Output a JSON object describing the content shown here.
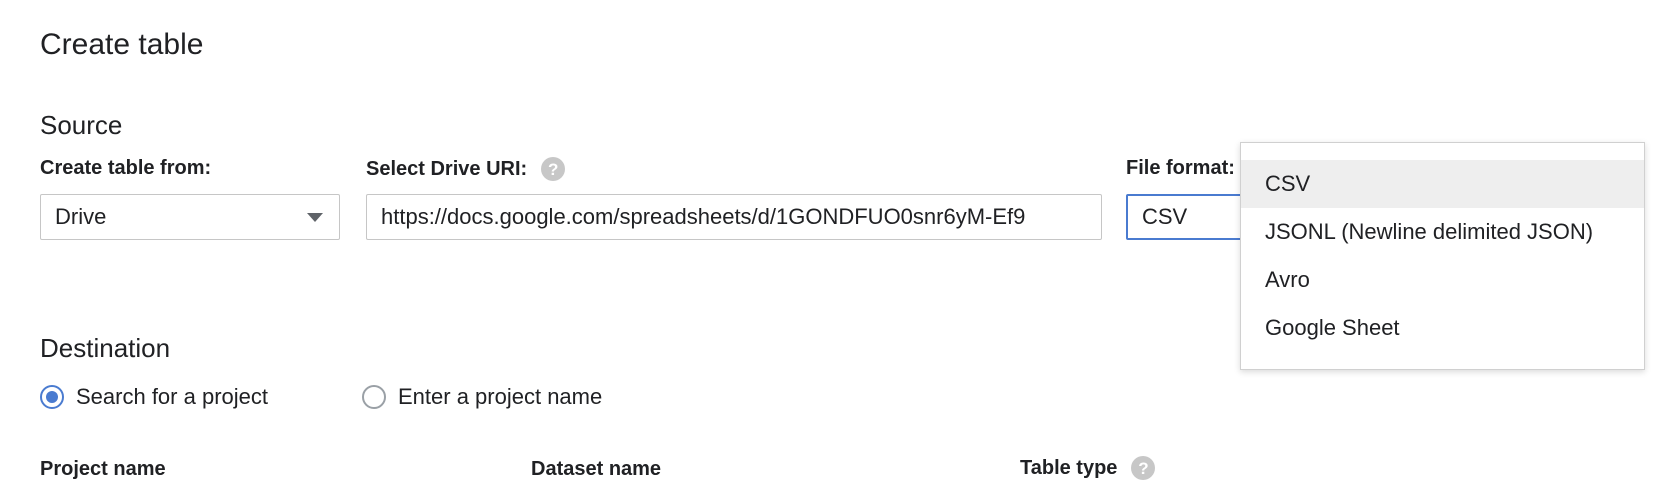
{
  "page": {
    "title": "Create table"
  },
  "source": {
    "title": "Source",
    "create_from": {
      "label": "Create table from:",
      "value": "Drive"
    },
    "drive_uri": {
      "label": "Select Drive URI:",
      "value": "https://docs.google.com/spreadsheets/d/1GONDFUO0snr6yM-Ef9"
    },
    "file_format": {
      "label": "File format:",
      "value": "CSV",
      "options": [
        "CSV",
        "JSONL (Newline delimited JSON)",
        "Avro",
        "Google Sheet"
      ],
      "highlighted": "CSV"
    }
  },
  "destination": {
    "title": "Destination",
    "radio_search": "Search for a project",
    "radio_enter": "Enter a project name",
    "project_name_label": "Project name",
    "dataset_name_label": "Dataset name",
    "table_type_label": "Table type"
  },
  "icons": {
    "help": "help-icon",
    "dropdown": "chevron-down-icon"
  },
  "colors": {
    "accent": "#4a7bd0",
    "border": "#c6c6c6",
    "help_icon": "#c7c7c7",
    "menu_highlight": "#eeeeee"
  }
}
